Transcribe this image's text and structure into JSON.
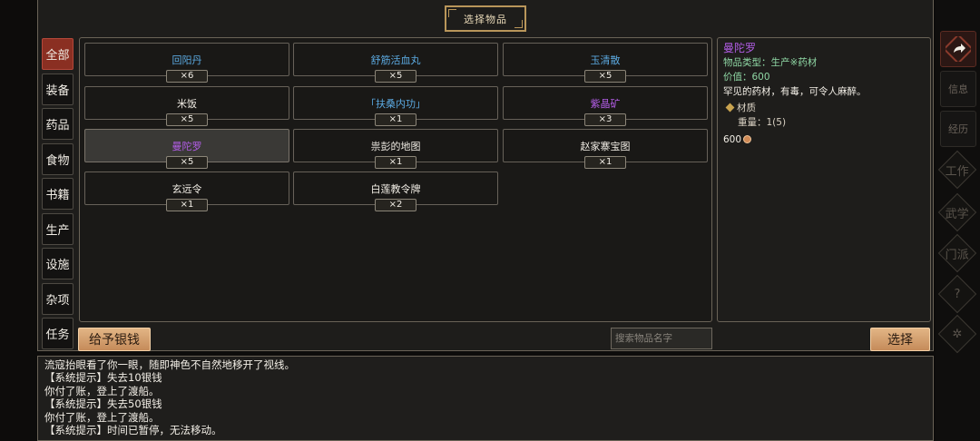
{
  "title": "选择物品",
  "tabs": [
    {
      "label": "全部",
      "active": true
    },
    {
      "label": "装备",
      "active": false
    },
    {
      "label": "药品",
      "active": false
    },
    {
      "label": "食物",
      "active": false
    },
    {
      "label": "书籍",
      "active": false
    },
    {
      "label": "生产",
      "active": false
    },
    {
      "label": "设施",
      "active": false
    },
    {
      "label": "杂项",
      "active": false
    },
    {
      "label": "任务",
      "active": false
    }
  ],
  "items": [
    {
      "name": "回阳丹",
      "qty": "×6",
      "color": "blue",
      "selected": false
    },
    {
      "name": "舒筋活血丸",
      "qty": "×5",
      "color": "blue",
      "selected": false
    },
    {
      "name": "玉清散",
      "qty": "×5",
      "color": "blue",
      "selected": false
    },
    {
      "name": "米饭",
      "qty": "×5",
      "color": "white",
      "selected": false
    },
    {
      "name": "「扶桑内功」",
      "qty": "×1",
      "color": "blue",
      "selected": false
    },
    {
      "name": "紫晶矿",
      "qty": "×3",
      "color": "purple",
      "selected": false
    },
    {
      "name": "曼陀罗",
      "qty": "×5",
      "color": "purple",
      "selected": true
    },
    {
      "name": "祟彭的地图",
      "qty": "×1",
      "color": "white",
      "selected": false
    },
    {
      "name": "赵家寨宝图",
      "qty": "×1",
      "color": "white",
      "selected": false
    },
    {
      "name": "玄远令",
      "qty": "×1",
      "color": "white",
      "selected": false
    },
    {
      "name": "白莲教令牌",
      "qty": "×2",
      "color": "white",
      "selected": false
    }
  ],
  "detail": {
    "name": "曼陀罗",
    "type_line": "物品类型：生产※药材",
    "value_line": "价值：600",
    "description": "罕见的药材，有毒，可令人麻醉。",
    "section_title": "材质",
    "weight_line": "重量：1(5)",
    "price": "600"
  },
  "buttons": {
    "give_money": "给予银钱",
    "select": "选择"
  },
  "search": {
    "placeholder": "搜索物品名字"
  },
  "log": [
    "流寇抬眼看了你一眼，随即神色不自然地移开了视线。",
    "【系统提示】失去10银钱",
    "你付了账，登上了渡船。",
    "【系统提示】失去50银钱",
    "你付了账，登上了渡船。",
    "【系统提示】时间已暂停，无法移动。"
  ],
  "right_nav": {
    "info": "信息",
    "jingli": "经历",
    "side_labels": [
      "工作",
      "武学",
      "门派"
    ],
    "help": "?"
  }
}
